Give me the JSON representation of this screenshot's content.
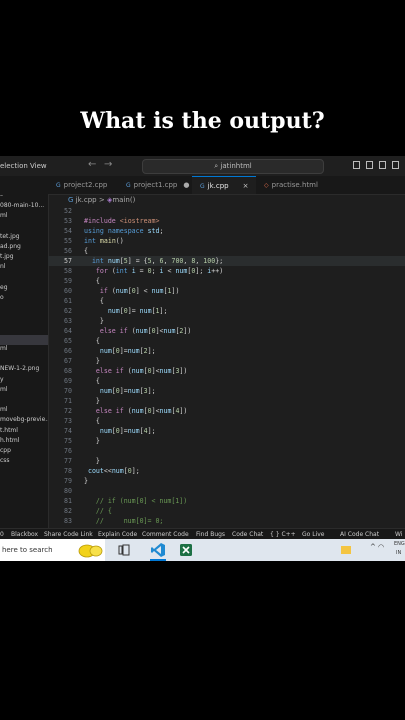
{
  "caption": "What is the output?",
  "titlebar": {
    "menu_selection": "election",
    "menu_view": "View",
    "search_text": "jatinhtml",
    "nav_back": "←",
    "nav_forward": "→"
  },
  "sidebar": {
    "items": [
      "–",
      "080-main-10...",
      "ml",
      "",
      "tet.jpg",
      "ad.png",
      "t.jpg",
      "nl",
      "",
      "eg",
      "o",
      "",
      "",
      "",
      "",
      "ml",
      "",
      "NEW-1-2.png",
      "y",
      "ml",
      "",
      "ml",
      "movebg-previe...",
      "t.html",
      "h.html",
      "cpp",
      "css"
    ]
  },
  "tabs": [
    {
      "label": "project2.cpp",
      "state": ""
    },
    {
      "label": "project1.cpp",
      "state": "●"
    },
    {
      "label": "jk.cpp",
      "state": "×"
    },
    {
      "label": "practise.html",
      "state": ""
    }
  ],
  "breadcrumb": {
    "file": "jk.cpp",
    "sep": ">",
    "symbol": "main()"
  },
  "editor": {
    "current_line": "57",
    "lines": [
      {
        "n": "52",
        "t": ""
      },
      {
        "n": "53",
        "t": "#include <iostream>"
      },
      {
        "n": "54",
        "t": "using namespace std;"
      },
      {
        "n": "55",
        "t": "int main()"
      },
      {
        "n": "56",
        "t": "{"
      },
      {
        "n": "57",
        "t": "  int num[5] = {5, 6, 700, 8, 100};"
      },
      {
        "n": "58",
        "t": "   for (int i = 0; i < num[0]; i++)"
      },
      {
        "n": "59",
        "t": "   {"
      },
      {
        "n": "60",
        "t": "    if (num[0] < num[1])"
      },
      {
        "n": "61",
        "t": "    {"
      },
      {
        "n": "62",
        "t": "      num[0]= num[1];"
      },
      {
        "n": "63",
        "t": "    }"
      },
      {
        "n": "64",
        "t": "    else if (num[0]<num[2])"
      },
      {
        "n": "65",
        "t": "   {"
      },
      {
        "n": "66",
        "t": "    num[0]=num[2];"
      },
      {
        "n": "67",
        "t": "   }"
      },
      {
        "n": "68",
        "t": "   else if (num[0]<num[3])"
      },
      {
        "n": "69",
        "t": "   {"
      },
      {
        "n": "70",
        "t": "    num[0]=num[3];"
      },
      {
        "n": "71",
        "t": "   }"
      },
      {
        "n": "72",
        "t": "   else if (num[0]<num[4])"
      },
      {
        "n": "73",
        "t": "   {"
      },
      {
        "n": "74",
        "t": "    num[0]=num[4];"
      },
      {
        "n": "75",
        "t": "   }"
      },
      {
        "n": "76",
        "t": ""
      },
      {
        "n": "77",
        "t": "   }"
      },
      {
        "n": "78",
        "t": " cout<<num[0];"
      },
      {
        "n": "79",
        "t": "}"
      },
      {
        "n": "80",
        "t": ""
      },
      {
        "n": "81",
        "t": "   // if (num[0] < num[1])"
      },
      {
        "n": "82",
        "t": "   // {"
      },
      {
        "n": "83",
        "t": "   //     num[0]= 0;"
      }
    ]
  },
  "statusbar": {
    "items": [
      "0",
      "Blackbox",
      "Share Code Link",
      "Explain Code",
      "Comment Code",
      "Find Bugs",
      "Code Chat",
      "{ } C++",
      "Go Live",
      "AI Code Chat",
      "Wi"
    ]
  },
  "taskbar": {
    "search_placeholder": "here to search",
    "tray_lang": "ENG",
    "tray_region": "IN"
  },
  "colors": {
    "keyword": "#569cd6",
    "control": "#c586c0",
    "string": "#ce9178",
    "number": "#b5cea8",
    "comment": "#6a9955",
    "variable": "#9cdcfe",
    "function": "#dcdcaa",
    "accent": "#0078d4"
  }
}
